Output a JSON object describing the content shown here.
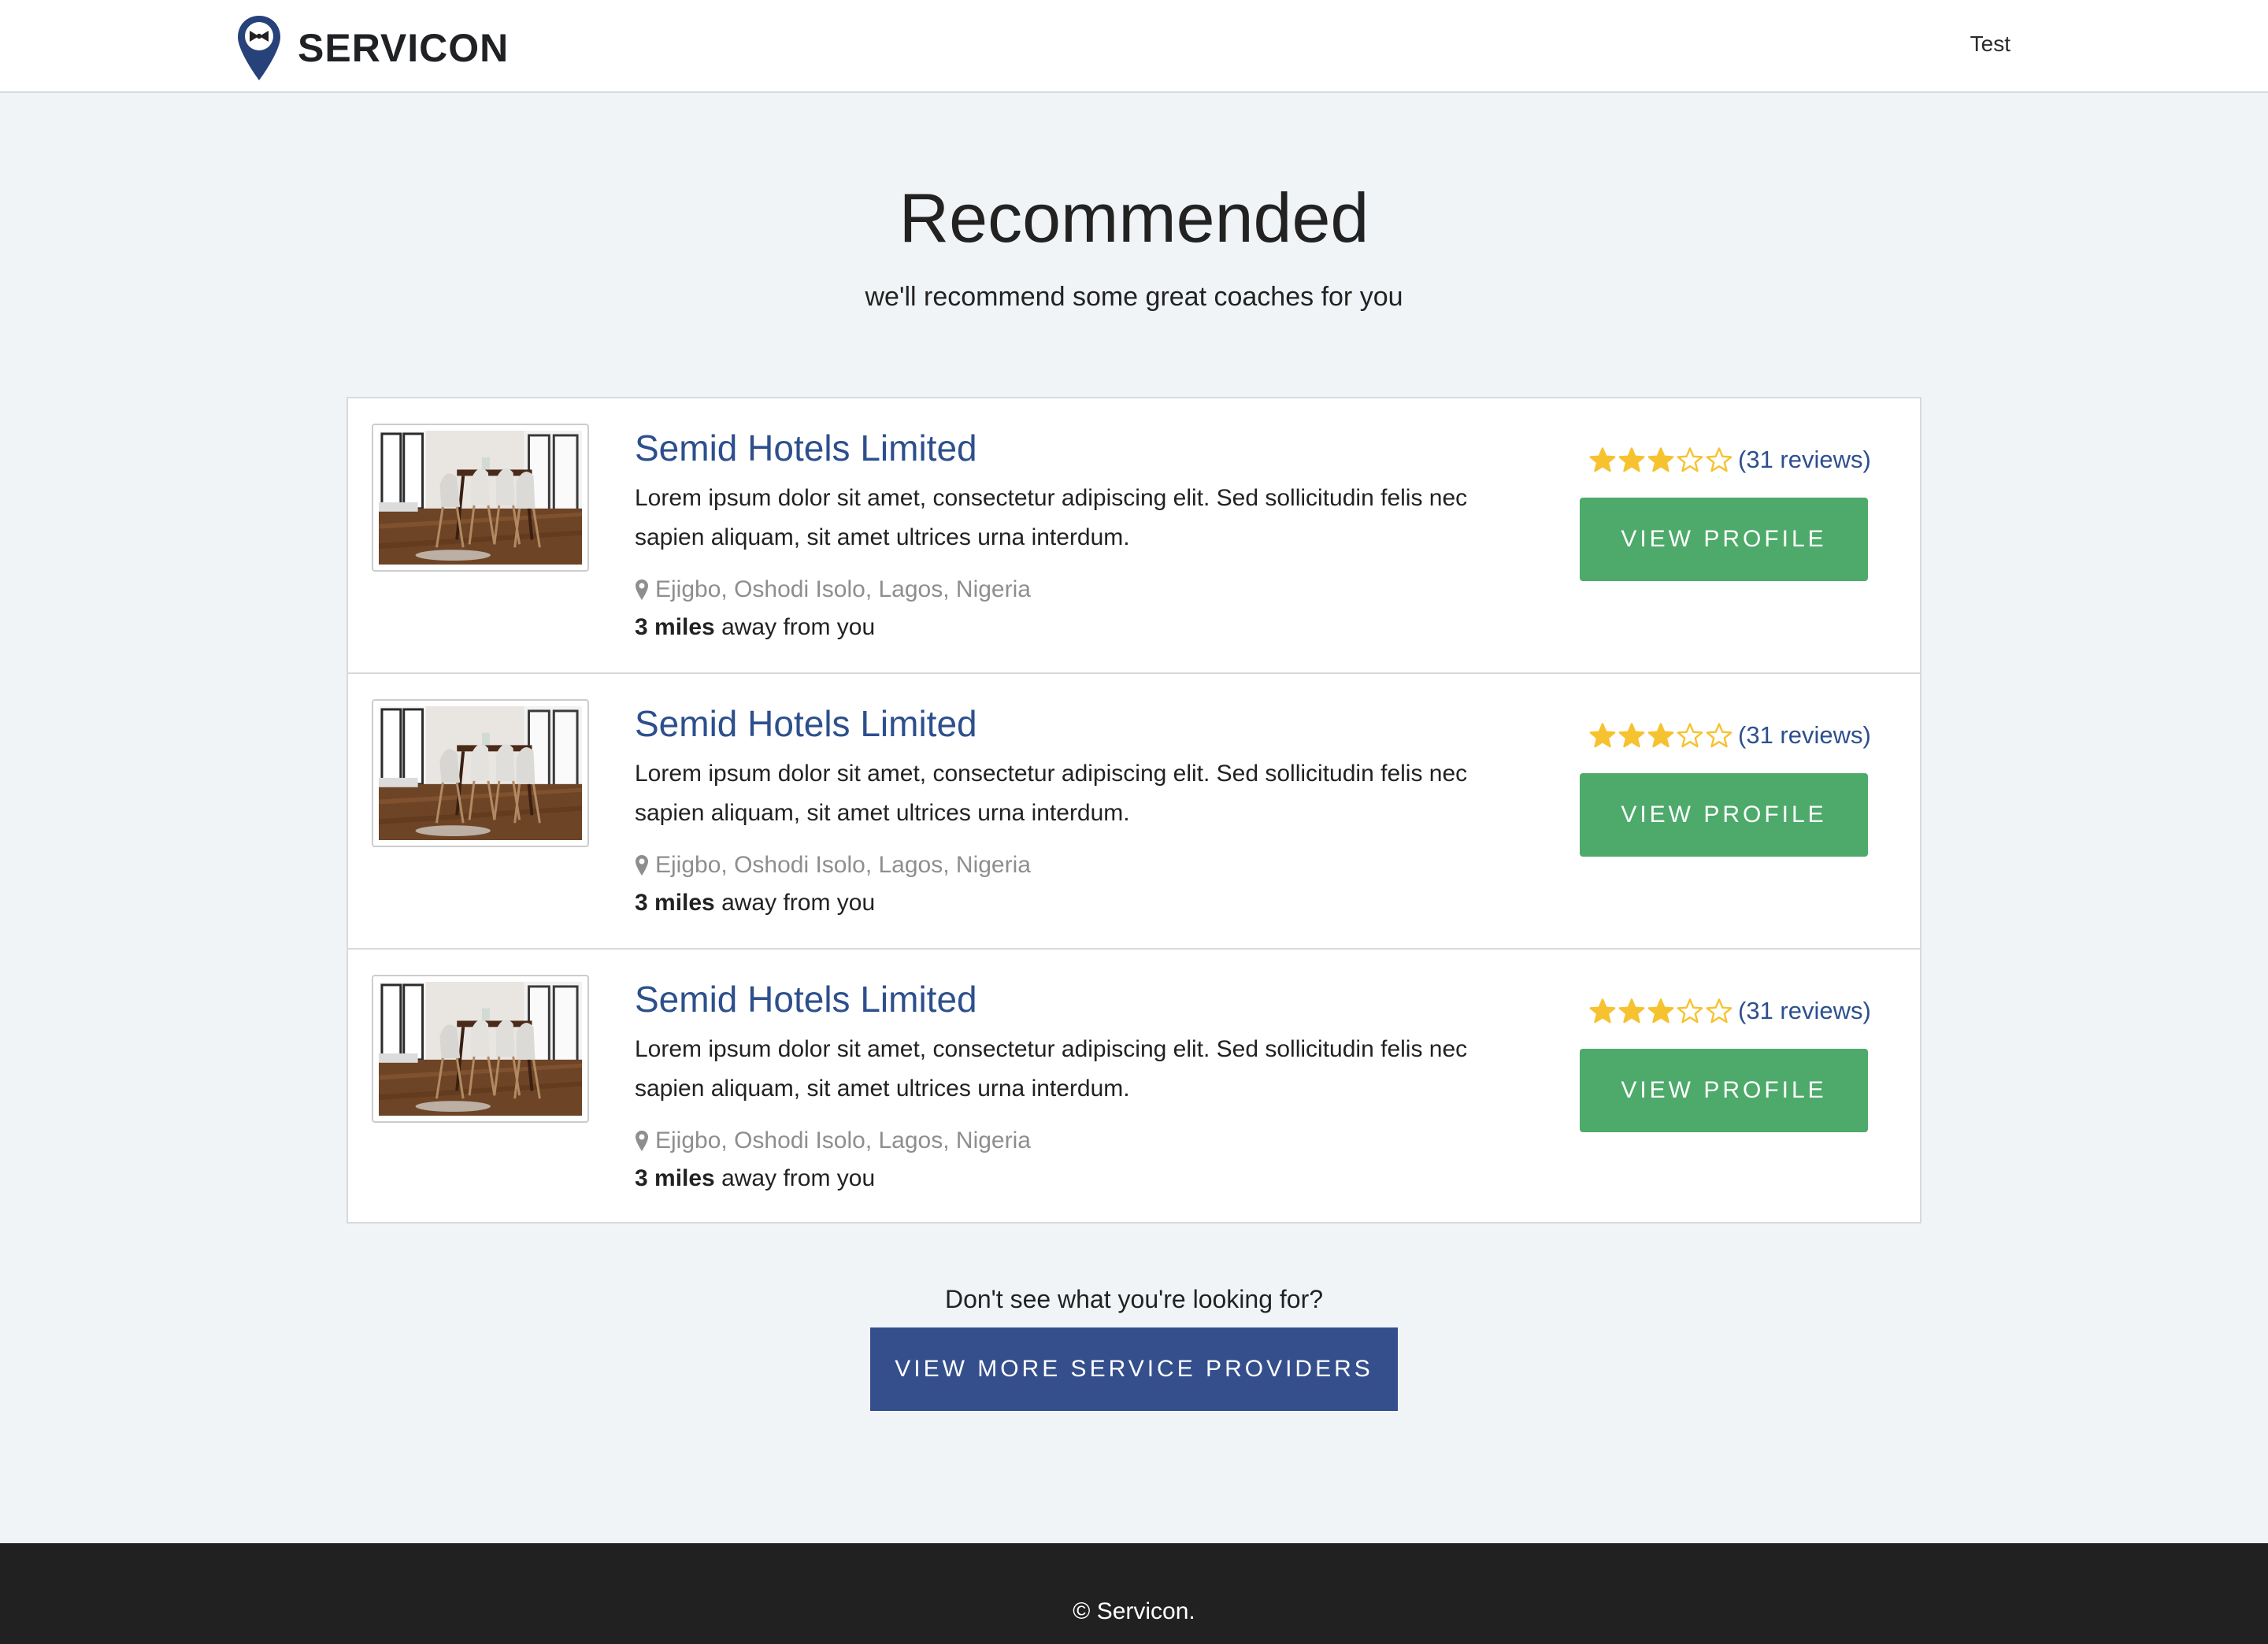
{
  "header": {
    "brand": "SERVICON",
    "user_label": "Test"
  },
  "hero": {
    "title": "Recommended",
    "subtitle": "we'll recommend some great coaches for you"
  },
  "providers": [
    {
      "name": "Semid Hotels Limited",
      "description": "Lorem ipsum dolor sit amet, consectetur adipiscing elit. Sed sollicitudin felis nec sapien aliquam, sit amet ultrices urna interdum.",
      "location": "Ejigbo, Oshodi Isolo, Lagos, Nigeria",
      "distance_value": "3 miles",
      "distance_suffix": " away from you",
      "rating": 3,
      "rating_max": 5,
      "reviews": "(31 reviews)",
      "button_label": "VIEW PROFILE"
    },
    {
      "name": "Semid Hotels Limited",
      "description": "Lorem ipsum dolor sit amet, consectetur adipiscing elit. Sed sollicitudin felis nec sapien aliquam, sit amet ultrices urna interdum.",
      "location": "Ejigbo, Oshodi Isolo, Lagos, Nigeria",
      "distance_value": "3 miles",
      "distance_suffix": " away from you",
      "rating": 3,
      "rating_max": 5,
      "reviews": "(31 reviews)",
      "button_label": "VIEW PROFILE"
    },
    {
      "name": "Semid Hotels Limited",
      "description": "Lorem ipsum dolor sit amet, consectetur adipiscing elit. Sed sollicitudin felis nec sapien aliquam, sit amet ultrices urna interdum.",
      "location": "Ejigbo, Oshodi Isolo, Lagos, Nigeria",
      "distance_value": "3 miles",
      "distance_suffix": " away from you",
      "rating": 3,
      "rating_max": 5,
      "reviews": "(31 reviews)",
      "button_label": "VIEW PROFILE"
    }
  ],
  "cta": {
    "prompt": "Don't see what you're looking for?",
    "button_label": "VIEW MORE SERVICE PROVIDERS"
  },
  "footer": {
    "copyright": "© Servicon."
  },
  "colors": {
    "brand_blue": "#344f8c",
    "link_blue": "#2d4f8d",
    "action_green": "#4daa6a",
    "star_gold": "#f7c22f",
    "page_bg": "#f1f4f7",
    "footer_bg": "#212121"
  },
  "icons": {
    "logo": "map-pin-bowtie-icon",
    "location": "map-marker-icon",
    "star_filled": "star-filled-icon",
    "star_empty": "star-outline-icon"
  }
}
